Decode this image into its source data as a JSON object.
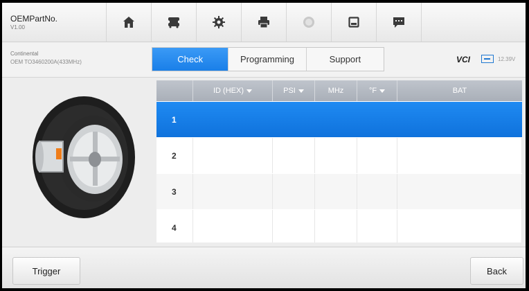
{
  "header": {
    "title": "OEMPartNo.",
    "version": "V1.00",
    "icons": [
      "home-icon",
      "vehicle-swap-icon",
      "settings-icon",
      "print-icon",
      "help-icon",
      "save-icon",
      "message-icon"
    ]
  },
  "subheader": {
    "maker": "Continental",
    "part": "OEM TO3460200A(433MHz)",
    "tabs": [
      {
        "label": "Check",
        "active": true
      },
      {
        "label": "Programming",
        "active": false
      },
      {
        "label": "Support",
        "active": false
      }
    ],
    "vci_label": "VCI",
    "voltage": "12.39V",
    "accent": "#1b82ea"
  },
  "table": {
    "columns": [
      "",
      "ID (HEX)",
      "PSI",
      "MHz",
      "°F",
      "BAT"
    ],
    "sortable": [
      false,
      true,
      true,
      false,
      true,
      false
    ],
    "rows": [
      {
        "num": "1",
        "id": "",
        "psi": "",
        "mhz": "",
        "temp": "",
        "bat": "",
        "selected": true
      },
      {
        "num": "2",
        "id": "",
        "psi": "",
        "mhz": "",
        "temp": "",
        "bat": "",
        "selected": false
      },
      {
        "num": "3",
        "id": "",
        "psi": "",
        "mhz": "",
        "temp": "",
        "bat": "",
        "selected": false
      },
      {
        "num": "4",
        "id": "",
        "psi": "",
        "mhz": "",
        "temp": "",
        "bat": "",
        "selected": false
      }
    ]
  },
  "footer": {
    "trigger_label": "Trigger",
    "back_label": "Back"
  }
}
